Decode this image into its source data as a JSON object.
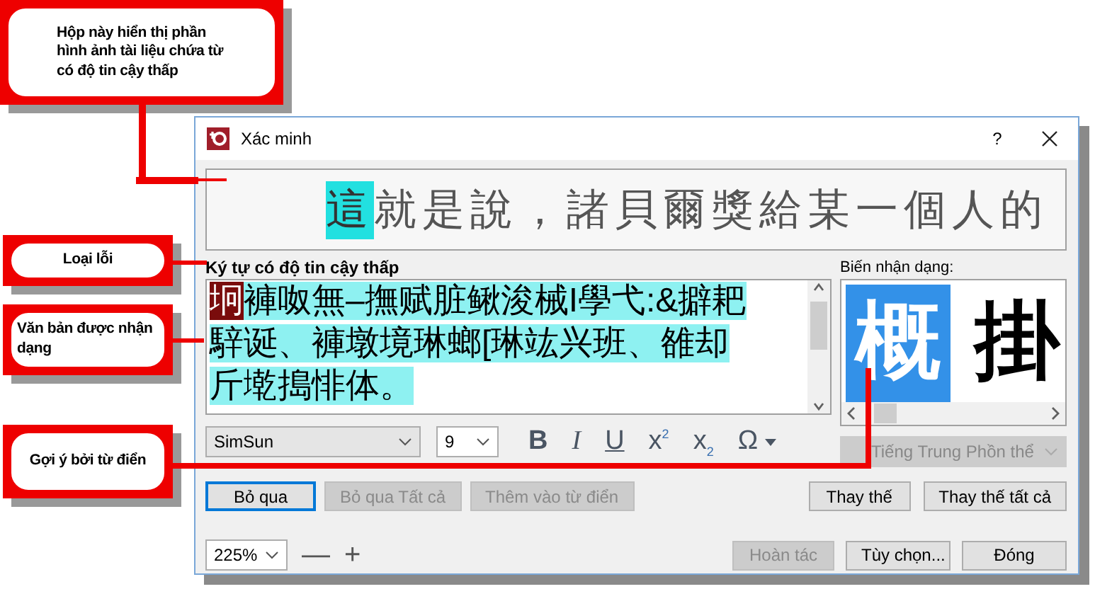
{
  "callouts": [
    {
      "text": "Hộp này hiển thị phần hình ảnh tài liệu chứa từ có độ tin cậy thấp"
    },
    {
      "text": "Loại lỗi"
    },
    {
      "text": "Văn bản được nhận dạng"
    },
    {
      "text": "Gợi ý bởi từ điển"
    }
  ],
  "window": {
    "title": "Xác minh",
    "help": "?"
  },
  "image_strip": {
    "highlighted": "這",
    "rest": "就是說，諸貝爾獎給某一個人的"
  },
  "error_type": "Ký tự có độ tin cậy thấp",
  "editor": {
    "lines": [
      [
        {
          "text": "坰",
          "kind": "error"
        },
        {
          "text": "褲呶無–撫赋脏鳅浚械I學弋:&擗耙",
          "kind": "uncertain"
        }
      ],
      [
        {
          "text": "騂诞、褲墩境琳螂[琳竑兴班、雒却",
          "kind": "uncertain"
        }
      ],
      [
        {
          "text": "斤墘搗悱体。",
          "kind": "uncertain"
        }
      ]
    ]
  },
  "variants": {
    "label": "Biến nhận dạng:",
    "items": [
      {
        "text": "概",
        "selected": true
      },
      {
        "text": "掛",
        "selected": false
      }
    ]
  },
  "language": {
    "value": "Tiếng Trung Phồn thể",
    "disabled": true
  },
  "format": {
    "font": "SimSun",
    "size": "9",
    "tools": [
      {
        "kind": "bold",
        "label": "B"
      },
      {
        "kind": "italic",
        "label": "I"
      },
      {
        "kind": "underline",
        "label": "U"
      },
      {
        "kind": "sup",
        "label": "x",
        "index": "2"
      },
      {
        "kind": "sub",
        "label": "x",
        "index": "2"
      },
      {
        "kind": "symbol",
        "label": "Ω"
      }
    ]
  },
  "buttons": [
    {
      "label": "Bỏ qua",
      "default": true,
      "disabled": false
    },
    {
      "label": "Bỏ qua Tất cả",
      "default": false,
      "disabled": true
    },
    {
      "label": "Thêm vào từ điển",
      "default": false,
      "disabled": true
    },
    {
      "label": "Thay thế",
      "default": false,
      "disabled": false
    },
    {
      "label": "Thay thế tất cả",
      "default": false,
      "disabled": false
    }
  ],
  "zoom": {
    "value": "225%",
    "minus": "—",
    "plus": "+"
  },
  "bottom_buttons": [
    {
      "label": "Hoàn tác",
      "default": false,
      "disabled": true
    },
    {
      "label": "Tùy chọn...",
      "default": false,
      "disabled": false
    },
    {
      "label": "Đóng",
      "default": false,
      "disabled": false
    }
  ]
}
